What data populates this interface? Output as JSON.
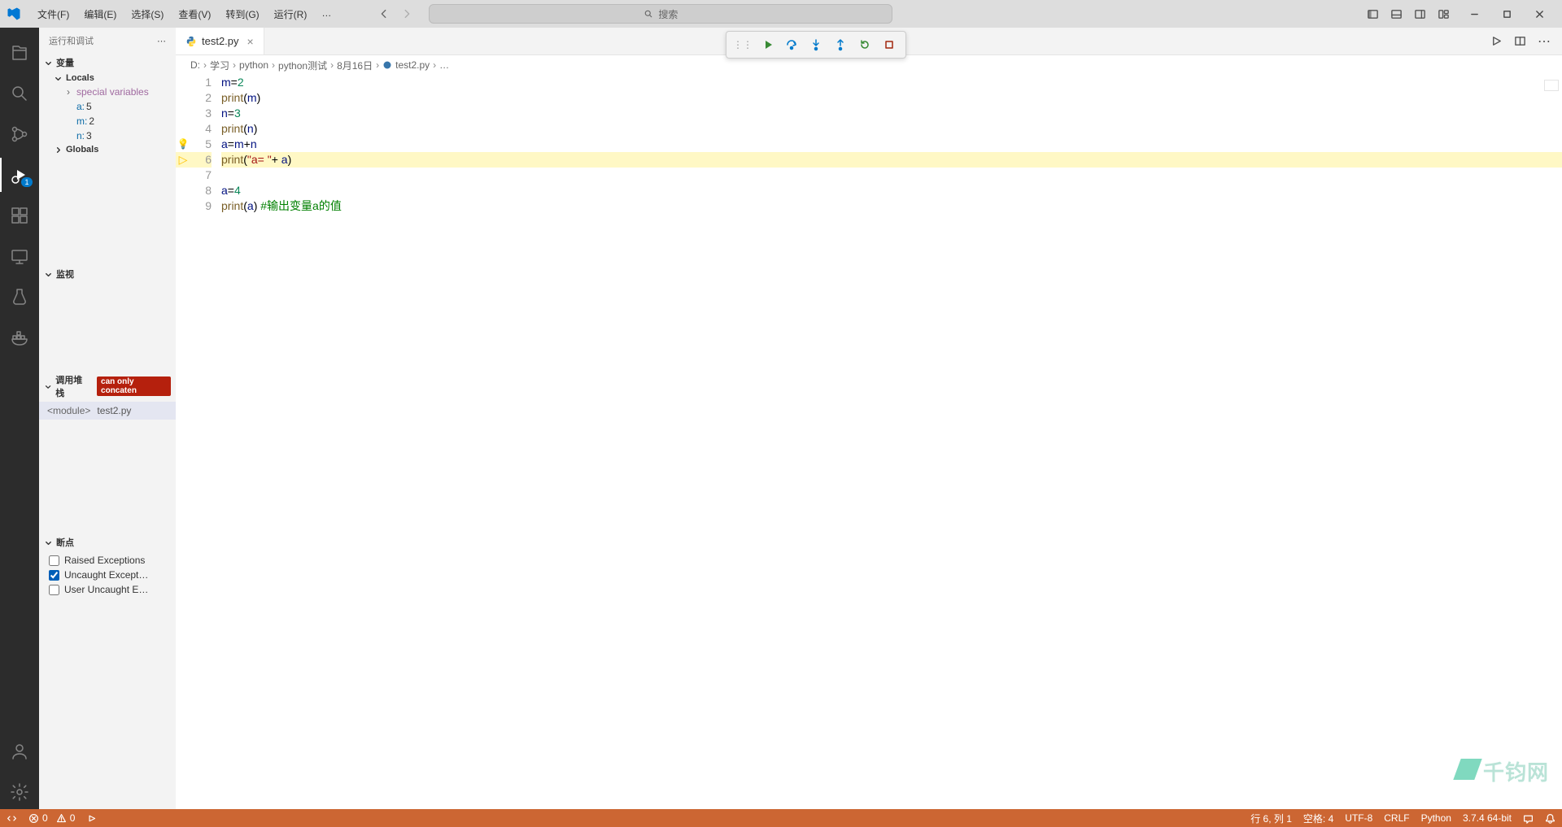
{
  "menu": {
    "file": "文件(F)",
    "edit": "编辑(E)",
    "select": "选择(S)",
    "view": "查看(V)",
    "goto": "转到(G)",
    "run": "运行(R)",
    "more": "…"
  },
  "search": {
    "placeholder": "搜索"
  },
  "activitybar": {
    "debug_badge": "1"
  },
  "sidebar": {
    "title": "运行和调试",
    "variables": {
      "header": "变量",
      "locals": "Locals",
      "special": "special variables",
      "vars": [
        {
          "name": "a:",
          "val": "5"
        },
        {
          "name": "m:",
          "val": "2"
        },
        {
          "name": "n:",
          "val": "3"
        }
      ],
      "globals": "Globals"
    },
    "watch": {
      "header": "监视"
    },
    "callstack": {
      "header": "调用堆栈",
      "error": "can only concaten",
      "frame_module": "<module>",
      "frame_file": "test2.py"
    },
    "breakpoints": {
      "header": "断点",
      "items": [
        {
          "label": "Raised Exceptions",
          "checked": false
        },
        {
          "label": "Uncaught Except…",
          "checked": true
        },
        {
          "label": "User Uncaught E…",
          "checked": false
        }
      ]
    }
  },
  "tab": {
    "filename": "test2.py"
  },
  "breadcrumbs": [
    "D:",
    "学习",
    "python",
    "python测试",
    "8月16日",
    "test2.py",
    "…"
  ],
  "code": {
    "lines": [
      {
        "n": 1,
        "tokens": [
          [
            "var",
            "m"
          ],
          [
            "op",
            "="
          ],
          [
            "num",
            "2"
          ]
        ]
      },
      {
        "n": 2,
        "tokens": [
          [
            "fn",
            "print"
          ],
          [
            "op",
            "("
          ],
          [
            "var",
            "m"
          ],
          [
            "op",
            ")"
          ]
        ]
      },
      {
        "n": 3,
        "tokens": [
          [
            "var",
            "n"
          ],
          [
            "op",
            "="
          ],
          [
            "num",
            "3"
          ]
        ]
      },
      {
        "n": 4,
        "tokens": [
          [
            "fn",
            "print"
          ],
          [
            "op",
            "("
          ],
          [
            "var",
            "n"
          ],
          [
            "op",
            ")"
          ]
        ]
      },
      {
        "n": 5,
        "glyph": "bulb",
        "tokens": [
          [
            "var",
            "a"
          ],
          [
            "op",
            "="
          ],
          [
            "var",
            "m"
          ],
          [
            "op",
            "+"
          ],
          [
            "var",
            "n"
          ]
        ]
      },
      {
        "n": 6,
        "current": true,
        "glyph": "arrow",
        "tokens": [
          [
            "fn",
            "print"
          ],
          [
            "op",
            "("
          ],
          [
            "str",
            "\"a= \""
          ],
          [
            "op",
            "+ "
          ],
          [
            "var",
            "a"
          ],
          [
            "op",
            ")"
          ]
        ]
      },
      {
        "n": 7,
        "tokens": []
      },
      {
        "n": 8,
        "tokens": [
          [
            "var",
            "a"
          ],
          [
            "op",
            "="
          ],
          [
            "num",
            "4"
          ]
        ]
      },
      {
        "n": 9,
        "tokens": [
          [
            "fn",
            "print"
          ],
          [
            "op",
            "("
          ],
          [
            "var",
            "a"
          ],
          [
            "op",
            ") "
          ],
          [
            "cmt",
            "#输出变量a的值"
          ]
        ]
      }
    ]
  },
  "statusbar": {
    "errors": "0",
    "warnings": "0",
    "ln_col": "行 6, 列 1",
    "spaces": "空格: 4",
    "encoding": "UTF-8",
    "eol": "CRLF",
    "lang": "Python",
    "interpreter": "3.7.4 64-bit"
  },
  "watermark": "千钧网"
}
